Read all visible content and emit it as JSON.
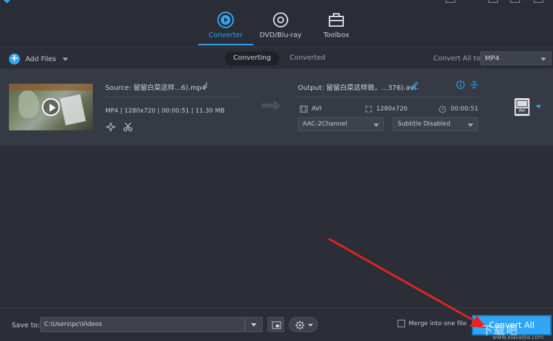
{
  "nav": {
    "tabs": [
      {
        "label": "Converter",
        "icon": "converter-icon",
        "active": true
      },
      {
        "label": "DVD/Blu-ray",
        "icon": "disc-icon",
        "active": false
      },
      {
        "label": "Toolbox",
        "icon": "toolbox-icon",
        "active": false
      }
    ]
  },
  "toolbar": {
    "add_files_label": "Add Files",
    "tab_converting": "Converting",
    "tab_converted": "Converted",
    "convert_all_to_label": "Convert All to:",
    "convert_all_format": "MP4"
  },
  "file": {
    "source_title": "Source: 留留白菜这样...6).mp4",
    "source_meta": "MP4 | 1280x720 | 00:00:51 | 11.30 MB",
    "output_title": "Output: 留留白菜这样做，...376).avi",
    "output_format": "AVI",
    "output_resolution": "1280x720",
    "output_duration": "00:00:51",
    "audio_track": "AAC-2Channel",
    "subtitle": "Subtitle Disabled",
    "badge_format": "AVI"
  },
  "bottom": {
    "save_to_label": "Save to:",
    "save_path": "C:\\Users\\pc\\Videos",
    "merge_label": "Merge into one file",
    "convert_all_label": "Convert All"
  },
  "watermark": {
    "text": "下载吧",
    "url": "www.xiazaiba.com"
  },
  "colors": {
    "accent": "#2fa7f4",
    "background": "#2b2e36",
    "row_background": "#363a44",
    "annotation_arrow": "#e8231d"
  }
}
